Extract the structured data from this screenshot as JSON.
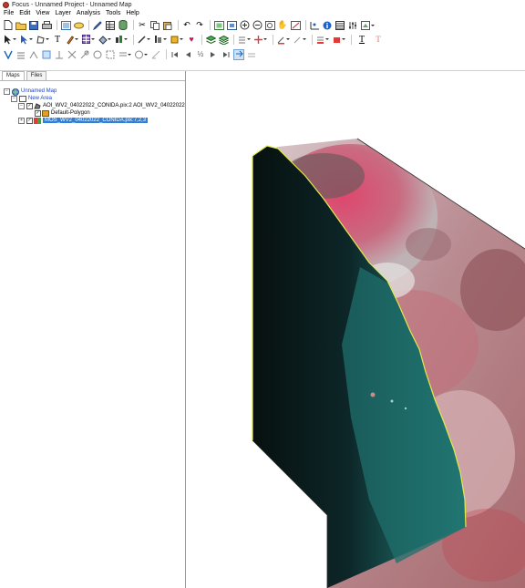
{
  "window": {
    "title": "Focus - Unnamed Project - Unnamed Map"
  },
  "menu": [
    "File",
    "Edit",
    "View",
    "Layer",
    "Analysis",
    "Tools",
    "Help"
  ],
  "toolbar_row1": [
    "new-file-icon",
    "open-folder-icon",
    "save-icon",
    "print-icon",
    "view-icon",
    "link-icon",
    "pencil-icon",
    "table-icon",
    "cylinder-icon",
    "cut-icon",
    "copy-icon",
    "paste-icon",
    "undo-icon",
    "redo-icon",
    "zoom-extent-icon",
    "zoom-layer-icon",
    "zoom-in-icon",
    "zoom-out-icon",
    "zoom-box-icon",
    "pan-hand-icon",
    "fit-icon",
    "coordinates-icon",
    "info-icon",
    "attributes-icon",
    "properties-icon",
    "image-options-icon"
  ],
  "toolbar_row2": [
    "select-arrow-icon",
    "edit-node-icon",
    "polygon-icon",
    "text-icon",
    "brush-icon",
    "grid-icon",
    "fill-icon",
    "symbol-icon",
    "line-style-icon",
    "layer-style-icon",
    "color-fill-icon",
    "heart-icon",
    "layer-stack-icon",
    "layer-group-icon",
    "layer-edit-icon",
    "crosshair-icon",
    "line-color-icon",
    "fill-color-icon",
    "text-color-icon",
    "font-size-icon"
  ],
  "toolbar_row3": [
    "tool-a-icon",
    "tool-b-icon",
    "tool-c-icon",
    "tool-d-icon",
    "tool-e-icon",
    "tool-f-icon",
    "tool-g-icon",
    "tool-h-icon",
    "tool-i-icon",
    "tool-j-icon",
    "first-frame-icon",
    "prev-frame-icon",
    "frame-ratio-icon",
    "play-icon",
    "last-frame-icon",
    "sync-icon",
    "extra-icon"
  ],
  "frame_ratio_label": "½",
  "tabs": [
    "Maps",
    "Files"
  ],
  "tree": {
    "map_name": "Unnamed Map",
    "area_name": "New Area",
    "layer1": "AOI_WV2_04022022_CONIDA.pix:2 AOI_WV2_04022022",
    "layer1_sub": "Default-Polygon",
    "layer2": "MOS_WV2_04022022_CONIDA.pix:7,2,3"
  },
  "colors": {
    "water_dark": "#0d1b1e",
    "water_turquoise": "#1f6f6c",
    "vegetation_red": "#d8425a",
    "land_pink": "#c9a6aa",
    "aoi_outline": "#e3e94a",
    "selection": "#2f7fd6"
  }
}
